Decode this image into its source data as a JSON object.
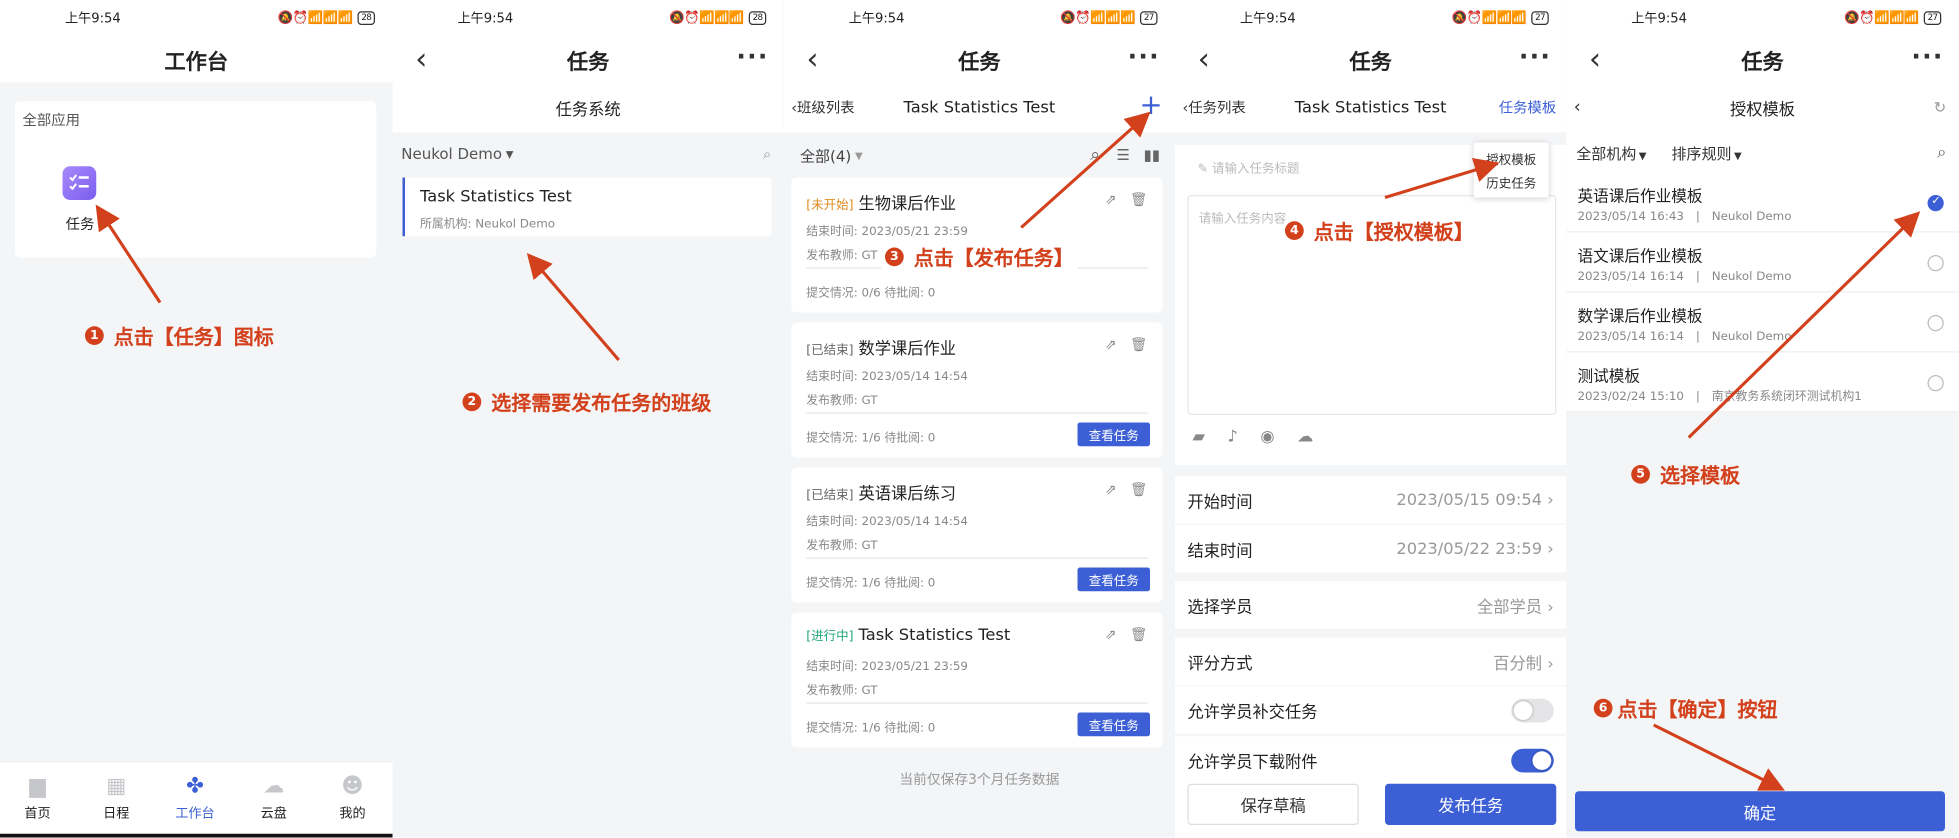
{
  "colors": {
    "accent": "#3c5fd6",
    "annotation": "#d2401c"
  },
  "status": {
    "time": "上午9:54",
    "icons": "🔕⏰📶📶📶",
    "battery_p12": "28",
    "battery_p345": "27"
  },
  "p1": {
    "title": "工作台",
    "section": "全部应用",
    "app_label": "任务",
    "annotation": "点击【任务】图标",
    "tabs": [
      {
        "label": "首页"
      },
      {
        "label": "日程"
      },
      {
        "label": "工作台"
      },
      {
        "label": "云盘"
      },
      {
        "label": "我的"
      }
    ]
  },
  "p2": {
    "title": "任务",
    "subheader": "任务系统",
    "filter": "Neukol Demo",
    "class_name": "Task Statistics Test",
    "class_org": "所属机构: Neukol Demo",
    "annotation": "选择需要发布任务的班级"
  },
  "p3": {
    "title": "任务",
    "back_label": "班级列表",
    "class_title": "Task Statistics Test",
    "filter": "全部(4)",
    "annotation": "点击【发布任务】",
    "view_label": "查看任务",
    "footer": "当前仅保存3个月任务数据",
    "tasks": [
      {
        "status": "[未开始]",
        "name": "生物课后作业",
        "end": "结束时间: 2023/05/21 23:59",
        "teacher": "发布教师: GT",
        "submit": "提交情况: 0/6 待批阅: 0"
      },
      {
        "status": "[已结束]",
        "name": "数学课后作业",
        "end": "结束时间: 2023/05/14 14:54",
        "teacher": "发布教师: GT",
        "submit": "提交情况: 1/6 待批阅: 0"
      },
      {
        "status": "[已结束]",
        "name": "英语课后练习",
        "end": "结束时间: 2023/05/14 14:54",
        "teacher": "发布教师: GT",
        "submit": "提交情况: 1/6 待批阅: 0"
      },
      {
        "status": "[进行中]",
        "name": "Task Statistics Test",
        "end": "结束时间: 2023/05/21 23:59",
        "teacher": "发布教师: GT",
        "submit": "提交情况: 1/6 待批阅: 0"
      }
    ]
  },
  "p4": {
    "title": "任务",
    "back_label": "任务列表",
    "class_title": "Task Statistics Test",
    "template_link": "任务模板",
    "menu": [
      "授权模板",
      "历史任务"
    ],
    "title_placeholder": "请输入任务标题",
    "content_placeholder": "请输入任务内容",
    "annotation": "点击【授权模板】",
    "rows": [
      {
        "label": "开始时间",
        "value": "2023/05/15 09:54"
      },
      {
        "label": "结束时间",
        "value": "2023/05/22 23:59"
      },
      {
        "label": "选择学员",
        "value": "全部学员"
      },
      {
        "label": "评分方式",
        "value": "百分制"
      }
    ],
    "toggle_makeup": "允许学员补交任务",
    "toggle_download": "允许学员下载附件",
    "save_draft": "保存草稿",
    "publish": "发布任务"
  },
  "p5": {
    "title": "授权模板",
    "filter_org": "全部机构",
    "filter_sort": "排序规则",
    "templates": [
      {
        "name": "英语课后作业模板",
        "date": "2023/05/14 16:43",
        "org": "Neukol Demo"
      },
      {
        "name": "语文课后作业模板",
        "date": "2023/05/14 16:14",
        "org": "Neukol Demo"
      },
      {
        "name": "数学课后作业模板",
        "date": "2023/05/14 16:14",
        "org": "Neukol Demo"
      },
      {
        "name": "测试模板",
        "date": "2023/02/24 15:10",
        "org": "南京教务系统闭环测试机构1"
      }
    ],
    "annotation5": "选择模板",
    "annotation6": "点击【确定】按钮",
    "confirm": "确定"
  },
  "annot_nums": [
    "1",
    "2",
    "3",
    "4",
    "5",
    "6"
  ]
}
